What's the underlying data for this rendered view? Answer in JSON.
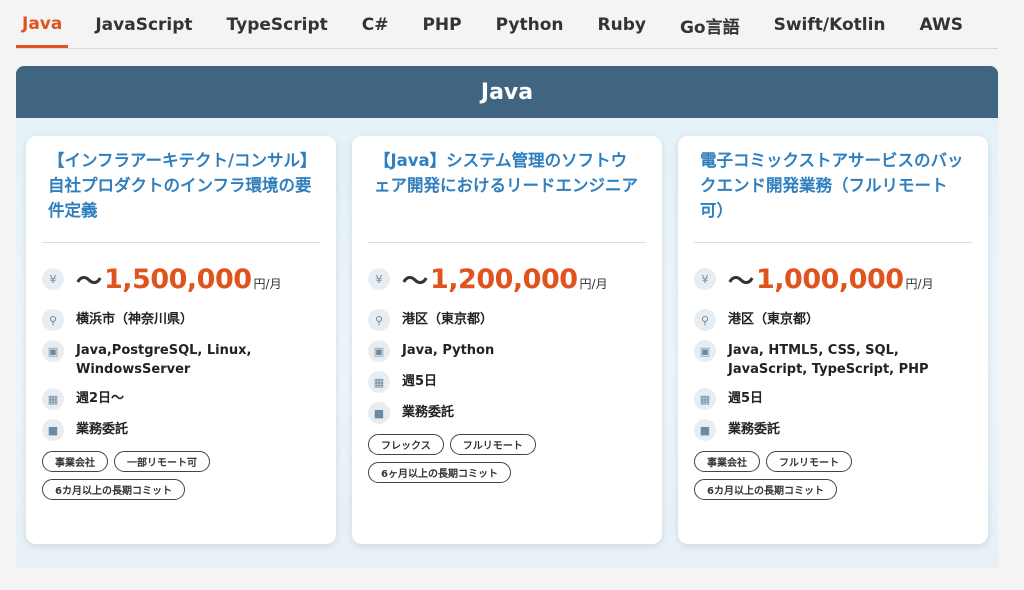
{
  "tabs": [
    {
      "label": "Java",
      "active": true
    },
    {
      "label": "JavaScript",
      "active": false
    },
    {
      "label": "TypeScript",
      "active": false
    },
    {
      "label": "C#",
      "active": false
    },
    {
      "label": "PHP",
      "active": false
    },
    {
      "label": "Python",
      "active": false
    },
    {
      "label": "Ruby",
      "active": false
    },
    {
      "label": "Go言語",
      "active": false
    },
    {
      "label": "Swift/Kotlin",
      "active": false
    },
    {
      "label": "AWS",
      "active": false
    }
  ],
  "panel": {
    "title": "Java"
  },
  "colors": {
    "accent": "#e0531c",
    "header": "#3f6580",
    "title_link": "#2f7fbf"
  },
  "icons": {
    "price": "yen-icon",
    "location": "map-pin-icon",
    "skills": "laptop-icon",
    "schedule": "calendar-icon",
    "contract": "briefcase-icon"
  },
  "cards": [
    {
      "title": "【インフラアーキテクト/コンサル】自社プロダクトのインフラ環境の要件定義",
      "price_prefix": "〜",
      "price": "1,500,000",
      "price_unit": "円/月",
      "location": "横浜市（神奈川県）",
      "skills": "Java,PostgreSQL, Linux, WindowsServer",
      "schedule": "週2日〜",
      "contract": "業務委託",
      "tags": [
        "事業会社",
        "一部リモート可",
        "6カ月以上の長期コミット"
      ]
    },
    {
      "title": "【Java】システム管理のソフトウェア開発におけるリードエンジニア",
      "price_prefix": "〜",
      "price": "1,200,000",
      "price_unit": "円/月",
      "location": "港区（東京都）",
      "skills": "Java, Python",
      "schedule": "週5日",
      "contract": "業務委託",
      "tags": [
        "フレックス",
        "フルリモート",
        "6ヶ月以上の長期コミット"
      ]
    },
    {
      "title": "電子コミックストアサービスのバックエンド開発業務（フルリモート可）",
      "price_prefix": "〜",
      "price": "1,000,000",
      "price_unit": "円/月",
      "location": "港区（東京都）",
      "skills": "Java, HTML5, CSS, SQL, JavaScript, TypeScript, PHP",
      "schedule": "週5日",
      "contract": "業務委託",
      "tags": [
        "事業会社",
        "フルリモート",
        "6カ月以上の長期コミット"
      ]
    }
  ]
}
